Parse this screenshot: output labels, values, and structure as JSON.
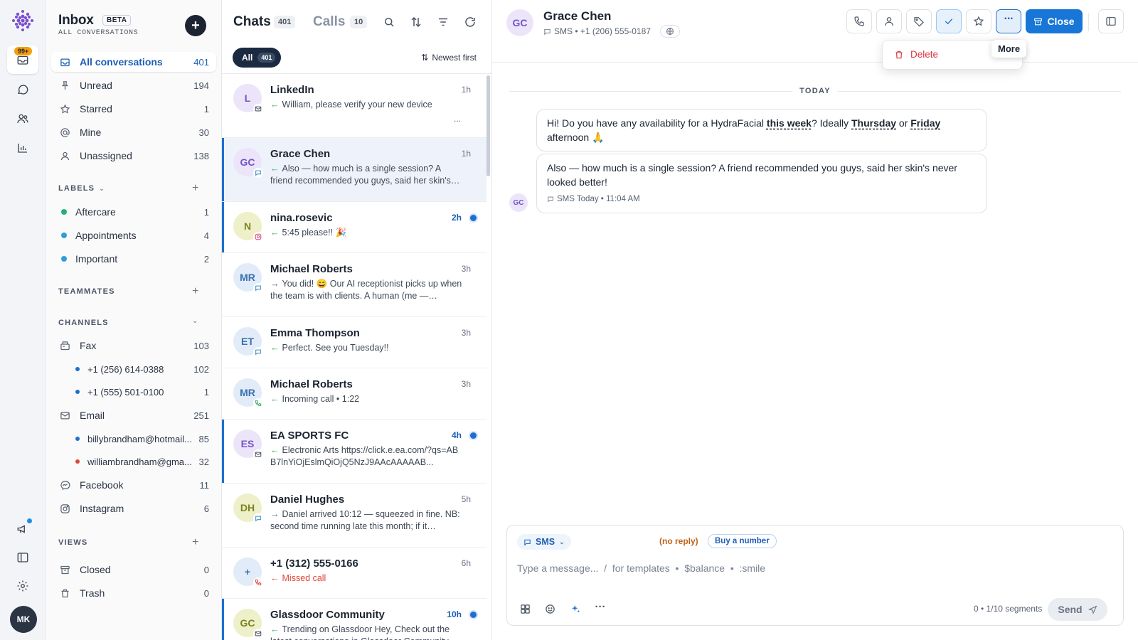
{
  "rail": {
    "badge": "99+",
    "user_initials": "MK"
  },
  "sidebar": {
    "title": "Inbox",
    "beta": "BETA",
    "subtitle": "ALL CONVERSATIONS",
    "items": [
      {
        "label": "All conversations",
        "count": "401"
      },
      {
        "label": "Unread",
        "count": "194"
      },
      {
        "label": "Starred",
        "count": "1"
      },
      {
        "label": "Mine",
        "count": "30"
      },
      {
        "label": "Unassigned",
        "count": "138"
      }
    ],
    "labels_header": "LABELS",
    "labels": [
      {
        "label": "Aftercare",
        "count": "1",
        "color": "#22b07d"
      },
      {
        "label": "Appointments",
        "count": "4",
        "color": "#2e9fd6"
      },
      {
        "label": "Important",
        "count": "2",
        "color": "#2e9fd6"
      }
    ],
    "teammates_header": "TEAMMATES",
    "channels_header": "CHANNELS",
    "channels": [
      {
        "label": "Fax",
        "count": "103"
      },
      {
        "label": "+1 (256) 614-0388",
        "count": "102",
        "color": "#1d6fd1"
      },
      {
        "label": "+1 (555) 501-0100",
        "count": "1",
        "color": "#1d6fd1"
      },
      {
        "label": "Email",
        "count": "251"
      },
      {
        "label": "billybrandham@hotmail...",
        "count": "85",
        "color": "#1d6fd1"
      },
      {
        "label": "williambrandham@gma...",
        "count": "32",
        "color": "#e0453a"
      },
      {
        "label": "Facebook",
        "count": "11"
      },
      {
        "label": "Instagram",
        "count": "6"
      }
    ],
    "views_header": "VIEWS",
    "views": [
      {
        "label": "Closed",
        "count": "0"
      },
      {
        "label": "Trash",
        "count": "0"
      }
    ]
  },
  "list": {
    "tab_chats": "Chats",
    "tab_chats_count": "401",
    "tab_calls": "Calls",
    "tab_calls_count": "10",
    "filter_all": "All",
    "filter_all_count": "401",
    "sort_label": "Newest first",
    "conversations": [
      {
        "initials": "L",
        "name": "LinkedIn",
        "time": "1h",
        "preview": "William, please verify your new device",
        "extra": "..."
      },
      {
        "initials": "GC",
        "name": "Grace Chen",
        "time": "1h",
        "preview": "Also — how much is a single session? A friend recommended you guys, said her skin's never..."
      },
      {
        "initials": "N",
        "name": "nina.rosevic",
        "time": "2h",
        "preview": "5:45 please!! 🎉"
      },
      {
        "initials": "MR",
        "name": "Michael Roberts",
        "time": "3h",
        "preview": "You did! 😄 Our AI receptionist picks up when the team is with clients. A human (me — Sarah!)..."
      },
      {
        "initials": "ET",
        "name": "Emma Thompson",
        "time": "3h",
        "preview": "Perfect. See you Tuesday!!"
      },
      {
        "initials": "MR",
        "name": "Michael Roberts",
        "time": "3h",
        "preview": "Incoming call • 1:22"
      },
      {
        "initials": "ES",
        "name": "EA SPORTS FC",
        "time": "4h",
        "preview": "Electronic Arts https://click.e.ea.com/?qs=ABB7lnYiOjEslmQiOjQ5NzJ9AAcAAAAAB..."
      },
      {
        "initials": "DH",
        "name": "Daniel Hughes",
        "time": "5h",
        "preview": "Daniel arrived 10:12 — squeezed in fine. NB: second time running late this month; if it happen..."
      },
      {
        "initials": "+",
        "name": "+1 (312) 555-0166",
        "time": "6h",
        "preview": "Missed call"
      },
      {
        "initials": "GC",
        "name": "Glassdoor Community",
        "time": "10h",
        "preview": "Trending on Glassdoor Hey, Check out the latest conversations in Glassdoor Community"
      }
    ]
  },
  "main": {
    "contact_initials": "GC",
    "contact_name": "Grace Chen",
    "contact_meta": "SMS • +1 (206) 555-0187",
    "close_label": "Close",
    "menu_delete": "Delete",
    "tooltip": "More",
    "day_label": "TODAY",
    "msg1_a": "Hi! Do you have any availability for a HydraFacial ",
    "msg1_b": "this week",
    "msg1_c": "? Ideally ",
    "msg1_d": "Thursday",
    "msg1_e": " or ",
    "msg1_f": "Friday",
    "msg1_g": " afternoon 🙏",
    "msg2": "Also — how much is a single session? A friend recommended you guys, said her skin's never looked better!",
    "msg2_meta": "SMS  Today • 11:04 AM",
    "composer_channel": "SMS",
    "no_reply": "(no reply)",
    "buy_number": "Buy a number",
    "placeholder": "Type a message...  /  for templates  •  $balance  •  :smile",
    "segments": "0 • 1/10 segments",
    "send": "Send"
  }
}
